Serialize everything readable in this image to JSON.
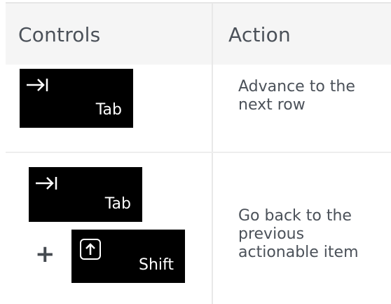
{
  "header": {
    "controls": "Controls",
    "action": "Action"
  },
  "rows": [
    {
      "keys": [
        {
          "label": "Tab",
          "icon": "tab-arrow-icon"
        }
      ],
      "action": [
        "Advance to the",
        "next row"
      ]
    },
    {
      "keys": [
        {
          "label": "Tab",
          "icon": "tab-arrow-icon"
        },
        {
          "label": "Shift",
          "icon": "shift-arrow-icon"
        }
      ],
      "combinator": "+",
      "action": [
        "Go back to the",
        "previous",
        "actionable item"
      ]
    }
  ],
  "colors": {
    "key_background": "#000000",
    "key_text": "#ffffff",
    "header_background": "#f5f5f5",
    "text": "#4b5159"
  }
}
